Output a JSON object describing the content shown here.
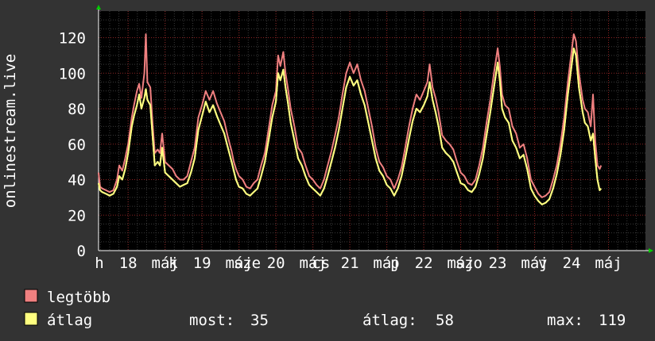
{
  "chart_data": {
    "type": "line",
    "ylabel": "onlinestream.live",
    "ylim": [
      0,
      135
    ],
    "yticks": [
      0,
      20,
      40,
      60,
      80,
      100,
      120
    ],
    "grid": true,
    "x_day_start": 17.6,
    "x_day_end": 25.0,
    "xticks": [
      {
        "day": 17.61,
        "label": "h"
      },
      {
        "day": 18.0,
        "label": "18"
      },
      {
        "day": 18.5,
        "label": "máj"
      },
      {
        "day": 18.61,
        "label": "k"
      },
      {
        "day": 19.0,
        "label": "19"
      },
      {
        "day": 19.5,
        "label": "máj"
      },
      {
        "day": 19.61,
        "label": "sze"
      },
      {
        "day": 20.0,
        "label": "20"
      },
      {
        "day": 20.5,
        "label": "máj"
      },
      {
        "day": 20.61,
        "label": "cs"
      },
      {
        "day": 21.0,
        "label": "21"
      },
      {
        "day": 21.5,
        "label": "máj"
      },
      {
        "day": 21.61,
        "label": "p"
      },
      {
        "day": 22.0,
        "label": "22"
      },
      {
        "day": 22.5,
        "label": "máj"
      },
      {
        "day": 22.61,
        "label": "szo"
      },
      {
        "day": 23.0,
        "label": "23"
      },
      {
        "day": 23.5,
        "label": "máj"
      },
      {
        "day": 23.61,
        "label": "v"
      },
      {
        "day": 24.0,
        "label": "24"
      },
      {
        "day": 24.5,
        "label": "máj"
      }
    ],
    "series": [
      {
        "name": "legtöbb",
        "color": "#f08080",
        "points": [
          [
            17.6,
            44
          ],
          [
            17.62,
            36
          ],
          [
            17.65,
            35
          ],
          [
            17.7,
            34
          ],
          [
            17.75,
            33
          ],
          [
            17.8,
            34
          ],
          [
            17.85,
            40
          ],
          [
            17.88,
            48
          ],
          [
            17.92,
            45
          ],
          [
            17.96,
            52
          ],
          [
            18.0,
            60
          ],
          [
            18.05,
            75
          ],
          [
            18.08,
            82
          ],
          [
            18.12,
            90
          ],
          [
            18.15,
            94
          ],
          [
            18.18,
            86
          ],
          [
            18.22,
            100
          ],
          [
            18.24,
            122
          ],
          [
            18.26,
            95
          ],
          [
            18.3,
            92
          ],
          [
            18.33,
            72
          ],
          [
            18.36,
            55
          ],
          [
            18.4,
            57
          ],
          [
            18.43,
            55
          ],
          [
            18.46,
            66
          ],
          [
            18.5,
            50
          ],
          [
            18.55,
            48
          ],
          [
            18.6,
            46
          ],
          [
            18.65,
            42
          ],
          [
            18.7,
            40
          ],
          [
            18.75,
            40
          ],
          [
            18.8,
            42
          ],
          [
            18.85,
            50
          ],
          [
            18.9,
            58
          ],
          [
            18.95,
            75
          ],
          [
            19.0,
            82
          ],
          [
            19.05,
            90
          ],
          [
            19.1,
            85
          ],
          [
            19.15,
            90
          ],
          [
            19.2,
            83
          ],
          [
            19.25,
            78
          ],
          [
            19.3,
            73
          ],
          [
            19.35,
            64
          ],
          [
            19.4,
            56
          ],
          [
            19.43,
            50
          ],
          [
            19.46,
            46
          ],
          [
            19.5,
            42
          ],
          [
            19.55,
            40
          ],
          [
            19.6,
            36
          ],
          [
            19.65,
            35
          ],
          [
            19.7,
            38
          ],
          [
            19.75,
            40
          ],
          [
            19.8,
            48
          ],
          [
            19.85,
            55
          ],
          [
            19.9,
            68
          ],
          [
            19.95,
            82
          ],
          [
            20.0,
            90
          ],
          [
            20.03,
            110
          ],
          [
            20.06,
            104
          ],
          [
            20.1,
            112
          ],
          [
            20.13,
            100
          ],
          [
            20.16,
            92
          ],
          [
            20.2,
            80
          ],
          [
            20.25,
            70
          ],
          [
            20.3,
            58
          ],
          [
            20.35,
            55
          ],
          [
            20.4,
            48
          ],
          [
            20.45,
            42
          ],
          [
            20.5,
            40
          ],
          [
            20.55,
            37
          ],
          [
            20.6,
            35
          ],
          [
            20.65,
            40
          ],
          [
            20.7,
            48
          ],
          [
            20.75,
            56
          ],
          [
            20.8,
            65
          ],
          [
            20.85,
            75
          ],
          [
            20.9,
            88
          ],
          [
            20.95,
            100
          ],
          [
            21.0,
            106
          ],
          [
            21.05,
            100
          ],
          [
            21.1,
            105
          ],
          [
            21.15,
            96
          ],
          [
            21.2,
            90
          ],
          [
            21.25,
            80
          ],
          [
            21.3,
            70
          ],
          [
            21.35,
            58
          ],
          [
            21.4,
            50
          ],
          [
            21.45,
            47
          ],
          [
            21.5,
            42
          ],
          [
            21.55,
            40
          ],
          [
            21.6,
            35
          ],
          [
            21.65,
            40
          ],
          [
            21.7,
            47
          ],
          [
            21.75,
            58
          ],
          [
            21.8,
            70
          ],
          [
            21.85,
            80
          ],
          [
            21.9,
            88
          ],
          [
            21.95,
            85
          ],
          [
            22.0,
            90
          ],
          [
            22.05,
            95
          ],
          [
            22.08,
            105
          ],
          [
            22.12,
            92
          ],
          [
            22.16,
            86
          ],
          [
            22.2,
            78
          ],
          [
            22.25,
            65
          ],
          [
            22.3,
            62
          ],
          [
            22.35,
            60
          ],
          [
            22.4,
            57
          ],
          [
            22.45,
            50
          ],
          [
            22.5,
            44
          ],
          [
            22.55,
            42
          ],
          [
            22.6,
            38
          ],
          [
            22.65,
            37
          ],
          [
            22.7,
            40
          ],
          [
            22.75,
            48
          ],
          [
            22.8,
            58
          ],
          [
            22.85,
            72
          ],
          [
            22.9,
            85
          ],
          [
            22.95,
            100
          ],
          [
            23.0,
            114
          ],
          [
            23.03,
            104
          ],
          [
            23.06,
            88
          ],
          [
            23.1,
            82
          ],
          [
            23.15,
            80
          ],
          [
            23.2,
            70
          ],
          [
            23.25,
            66
          ],
          [
            23.3,
            58
          ],
          [
            23.35,
            60
          ],
          [
            23.4,
            52
          ],
          [
            23.45,
            40
          ],
          [
            23.5,
            36
          ],
          [
            23.55,
            32
          ],
          [
            23.6,
            30
          ],
          [
            23.65,
            31
          ],
          [
            23.7,
            33
          ],
          [
            23.75,
            40
          ],
          [
            23.8,
            48
          ],
          [
            23.85,
            60
          ],
          [
            23.9,
            75
          ],
          [
            23.95,
            95
          ],
          [
            24.0,
            112
          ],
          [
            24.03,
            122
          ],
          [
            24.06,
            118
          ],
          [
            24.1,
            100
          ],
          [
            24.15,
            85
          ],
          [
            24.18,
            80
          ],
          [
            24.22,
            78
          ],
          [
            24.26,
            70
          ],
          [
            24.29,
            88
          ],
          [
            24.32,
            62
          ],
          [
            24.35,
            48
          ],
          [
            24.38,
            46
          ],
          [
            24.4,
            48
          ]
        ]
      },
      {
        "name": "átlag",
        "color": "#ffff80",
        "points": [
          [
            17.6,
            38
          ],
          [
            17.62,
            34
          ],
          [
            17.65,
            33
          ],
          [
            17.7,
            32
          ],
          [
            17.75,
            31
          ],
          [
            17.8,
            32
          ],
          [
            17.85,
            36
          ],
          [
            17.88,
            42
          ],
          [
            17.92,
            40
          ],
          [
            17.96,
            46
          ],
          [
            18.0,
            55
          ],
          [
            18.05,
            70
          ],
          [
            18.08,
            76
          ],
          [
            18.12,
            82
          ],
          [
            18.15,
            88
          ],
          [
            18.18,
            80
          ],
          [
            18.22,
            86
          ],
          [
            18.24,
            91
          ],
          [
            18.26,
            85
          ],
          [
            18.3,
            82
          ],
          [
            18.33,
            65
          ],
          [
            18.36,
            48
          ],
          [
            18.4,
            50
          ],
          [
            18.43,
            48
          ],
          [
            18.46,
            58
          ],
          [
            18.5,
            44
          ],
          [
            18.55,
            42
          ],
          [
            18.6,
            40
          ],
          [
            18.65,
            38
          ],
          [
            18.7,
            36
          ],
          [
            18.75,
            37
          ],
          [
            18.8,
            38
          ],
          [
            18.85,
            44
          ],
          [
            18.9,
            52
          ],
          [
            18.95,
            68
          ],
          [
            19.0,
            76
          ],
          [
            19.05,
            84
          ],
          [
            19.1,
            78
          ],
          [
            19.15,
            82
          ],
          [
            19.2,
            76
          ],
          [
            19.25,
            71
          ],
          [
            19.3,
            66
          ],
          [
            19.35,
            58
          ],
          [
            19.4,
            50
          ],
          [
            19.43,
            45
          ],
          [
            19.46,
            40
          ],
          [
            19.5,
            36
          ],
          [
            19.55,
            35
          ],
          [
            19.6,
            32
          ],
          [
            19.65,
            31
          ],
          [
            19.7,
            33
          ],
          [
            19.75,
            35
          ],
          [
            19.8,
            42
          ],
          [
            19.85,
            50
          ],
          [
            19.9,
            62
          ],
          [
            19.95,
            75
          ],
          [
            20.0,
            84
          ],
          [
            20.03,
            100
          ],
          [
            20.06,
            96
          ],
          [
            20.1,
            102
          ],
          [
            20.13,
            92
          ],
          [
            20.16,
            84
          ],
          [
            20.2,
            72
          ],
          [
            20.25,
            62
          ],
          [
            20.3,
            52
          ],
          [
            20.35,
            48
          ],
          [
            20.4,
            42
          ],
          [
            20.45,
            37
          ],
          [
            20.5,
            35
          ],
          [
            20.55,
            33
          ],
          [
            20.6,
            31
          ],
          [
            20.65,
            35
          ],
          [
            20.7,
            42
          ],
          [
            20.75,
            50
          ],
          [
            20.8,
            58
          ],
          [
            20.85,
            68
          ],
          [
            20.9,
            80
          ],
          [
            20.95,
            92
          ],
          [
            21.0,
            98
          ],
          [
            21.05,
            93
          ],
          [
            21.1,
            96
          ],
          [
            21.15,
            88
          ],
          [
            21.2,
            82
          ],
          [
            21.25,
            72
          ],
          [
            21.3,
            62
          ],
          [
            21.35,
            52
          ],
          [
            21.4,
            45
          ],
          [
            21.45,
            42
          ],
          [
            21.5,
            37
          ],
          [
            21.55,
            35
          ],
          [
            21.6,
            31
          ],
          [
            21.65,
            35
          ],
          [
            21.7,
            42
          ],
          [
            21.75,
            52
          ],
          [
            21.8,
            63
          ],
          [
            21.85,
            73
          ],
          [
            21.9,
            80
          ],
          [
            21.95,
            78
          ],
          [
            22.0,
            82
          ],
          [
            22.05,
            87
          ],
          [
            22.08,
            95
          ],
          [
            22.12,
            85
          ],
          [
            22.16,
            78
          ],
          [
            22.2,
            70
          ],
          [
            22.25,
            58
          ],
          [
            22.3,
            55
          ],
          [
            22.35,
            53
          ],
          [
            22.4,
            50
          ],
          [
            22.45,
            44
          ],
          [
            22.5,
            38
          ],
          [
            22.55,
            37
          ],
          [
            22.6,
            34
          ],
          [
            22.65,
            33
          ],
          [
            22.7,
            36
          ],
          [
            22.75,
            43
          ],
          [
            22.8,
            52
          ],
          [
            22.85,
            65
          ],
          [
            22.9,
            78
          ],
          [
            22.95,
            92
          ],
          [
            23.0,
            106
          ],
          [
            23.03,
            96
          ],
          [
            23.06,
            80
          ],
          [
            23.1,
            75
          ],
          [
            23.15,
            72
          ],
          [
            23.2,
            62
          ],
          [
            23.25,
            58
          ],
          [
            23.3,
            52
          ],
          [
            23.35,
            54
          ],
          [
            23.4,
            46
          ],
          [
            23.45,
            35
          ],
          [
            23.5,
            31
          ],
          [
            23.55,
            28
          ],
          [
            23.6,
            26
          ],
          [
            23.65,
            27
          ],
          [
            23.7,
            29
          ],
          [
            23.75,
            35
          ],
          [
            23.8,
            43
          ],
          [
            23.85,
            54
          ],
          [
            23.9,
            68
          ],
          [
            23.95,
            88
          ],
          [
            24.0,
            104
          ],
          [
            24.03,
            114
          ],
          [
            24.06,
            110
          ],
          [
            24.1,
            92
          ],
          [
            24.15,
            78
          ],
          [
            24.18,
            72
          ],
          [
            24.22,
            70
          ],
          [
            24.26,
            62
          ],
          [
            24.29,
            66
          ],
          [
            24.32,
            52
          ],
          [
            24.35,
            40
          ],
          [
            24.38,
            34
          ],
          [
            24.4,
            35
          ]
        ]
      }
    ],
    "stats": {
      "now_label": "most:",
      "now_value": "35",
      "avg_label": "átlag:",
      "avg_value": "58",
      "max_label": "max:",
      "max_value": "119"
    }
  }
}
